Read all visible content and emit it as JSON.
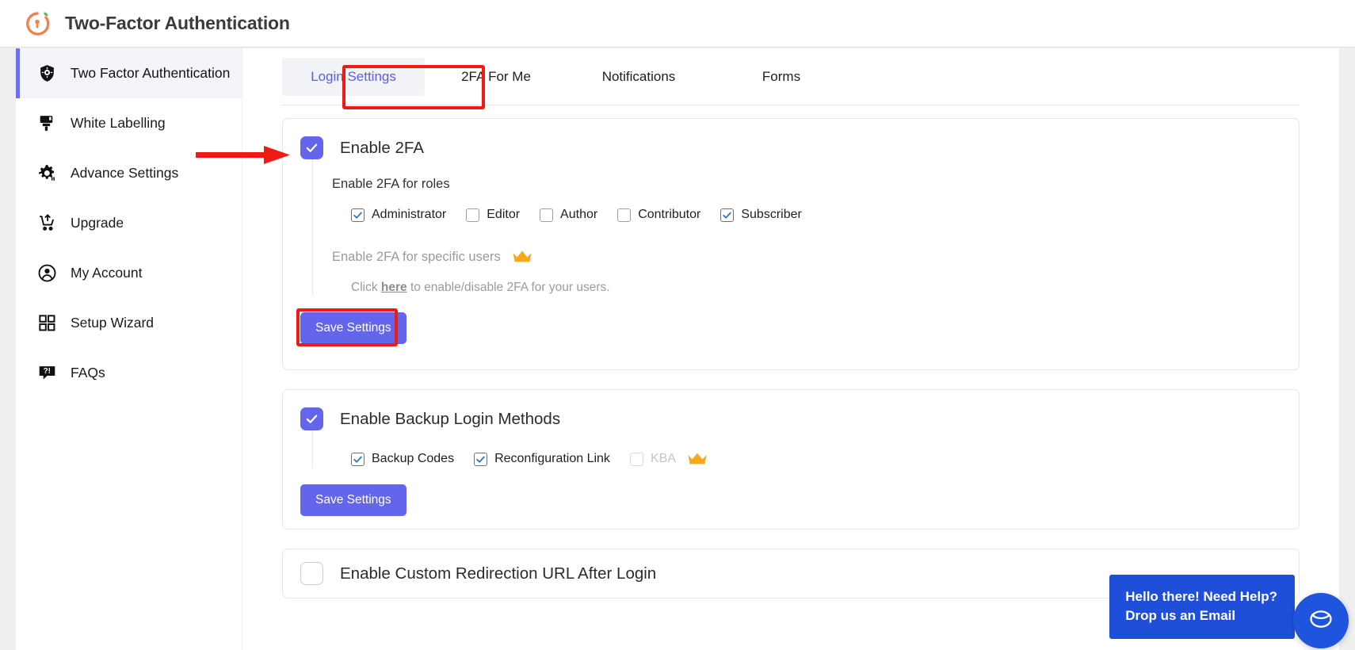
{
  "header": {
    "title": "Two-Factor Authentication",
    "logo_icon": "lock-clock-icon"
  },
  "sidebar": {
    "items": [
      {
        "label": "Two Factor Authentication",
        "icon": "shield-check-icon",
        "active": true
      },
      {
        "label": "White Labelling",
        "icon": "paint-brush-icon",
        "active": false
      },
      {
        "label": "Advance Settings",
        "icon": "gear-icon",
        "active": false
      },
      {
        "label": "Upgrade",
        "icon": "cart-upgrade-icon",
        "active": false
      },
      {
        "label": "My Account",
        "icon": "user-circle-icon",
        "active": false
      },
      {
        "label": "Setup Wizard",
        "icon": "grid-squares-icon",
        "active": false
      },
      {
        "label": "FAQs",
        "icon": "question-bubble-icon",
        "active": false
      }
    ]
  },
  "tabs": [
    {
      "label": "Login Settings",
      "active": true,
      "highlighted": true
    },
    {
      "label": "2FA For Me",
      "active": false,
      "highlighted": false
    },
    {
      "label": "Notifications",
      "active": false,
      "highlighted": false
    },
    {
      "label": "Forms",
      "active": false,
      "highlighted": false
    }
  ],
  "cards": {
    "enable_2fa": {
      "title": "Enable 2FA",
      "checked": true,
      "roles_label": "Enable 2FA for roles",
      "roles": [
        {
          "label": "Administrator",
          "checked": true,
          "disabled": false
        },
        {
          "label": "Editor",
          "checked": false,
          "disabled": false
        },
        {
          "label": "Author",
          "checked": false,
          "disabled": false
        },
        {
          "label": "Contributor",
          "checked": false,
          "disabled": false
        },
        {
          "label": "Subscriber",
          "checked": true,
          "disabled": false
        }
      ],
      "specific_users_label": "Enable 2FA for specific users",
      "specific_users_premium": true,
      "hint_prefix": "Click ",
      "hint_link": "here",
      "hint_suffix": " to enable/disable 2FA for your users.",
      "save_label": "Save Settings",
      "save_highlighted": true
    },
    "backup": {
      "title": "Enable Backup Login Methods",
      "checked": true,
      "methods": [
        {
          "label": "Backup Codes",
          "checked": true,
          "disabled": false
        },
        {
          "label": "Reconfiguration Link",
          "checked": true,
          "disabled": false
        },
        {
          "label": "KBA",
          "checked": false,
          "disabled": true
        }
      ],
      "kba_premium": true,
      "save_label": "Save Settings"
    },
    "redirect": {
      "title": "Enable Custom Redirection URL After Login",
      "checked": false
    }
  },
  "chat": {
    "bubble_text": "Hello there! Need Help?\nDrop us an Email",
    "button_icon": "envelope-icon"
  },
  "colors": {
    "accent_purple": "#6366ec",
    "highlight_red": "#ee1b15",
    "crown_gold": "#f7a81b",
    "chat_blue": "#1f54df",
    "logo_orange": "#ef8354"
  }
}
